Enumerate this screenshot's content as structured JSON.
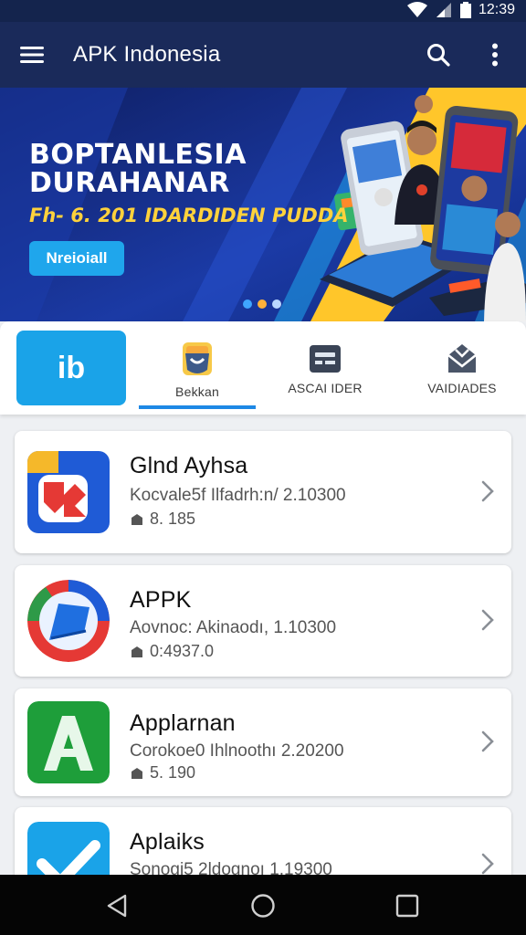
{
  "status_bar": {
    "time": "12:39"
  },
  "app_bar": {
    "title": "APK Indonesia",
    "icons": [
      "menu-icon",
      "search-icon",
      "more-vert-icon"
    ]
  },
  "banner": {
    "title_line1": "BOPTANLESIA",
    "title_line2": "DURAHANAR",
    "subtitle": "Fh- 6. 201 IDARDIDEN PUDDA",
    "button_label": "Nreioiall",
    "page_dots": 3,
    "active_dot": 0,
    "colors": {
      "bg": "#142a7c",
      "accent": "#ffc62a",
      "title": "#ffffff",
      "subtitle": "#ffd23c",
      "button": "#1fa6ec"
    }
  },
  "tabs": [
    {
      "label": "ib",
      "icon": "home-logo-icon",
      "active_bg": true
    },
    {
      "label": "Bekkan",
      "icon": "bag-icon",
      "selected": true
    },
    {
      "label": "ASCAI IDER",
      "icon": "card-icon",
      "selected": false
    },
    {
      "label": "VAIDIADES",
      "icon": "envelope-icon",
      "selected": false
    }
  ],
  "apps": [
    {
      "name": "Glnd Ayhsa",
      "meta": "Kocvale5f Ilfadrh:n/ 2.10300",
      "count": "8. 185",
      "icon": "red-arrow-app-icon"
    },
    {
      "name": "APPK",
      "meta": "Aovnoc: Akinaodı, 1.10300",
      "count": "0:4937.0",
      "icon": "blue-kite-app-icon"
    },
    {
      "name": "Applarnan",
      "meta": "Corokoe0 Ihlnoothı 2.20200",
      "count": "5. 190",
      "icon": "green-a-app-icon"
    },
    {
      "name": "Aplaiks",
      "meta": "Sonogi5 2ldognoı 1.19300",
      "count": "",
      "icon": "blue-check-app-icon"
    }
  ],
  "nav": {
    "icons": [
      "back-icon",
      "home-icon",
      "recents-icon"
    ]
  },
  "colors": {
    "app_bar": "#1a2a5a",
    "status_bar": "#14244d",
    "tab_accent": "#1e88e5",
    "background": "#eef0f3"
  }
}
